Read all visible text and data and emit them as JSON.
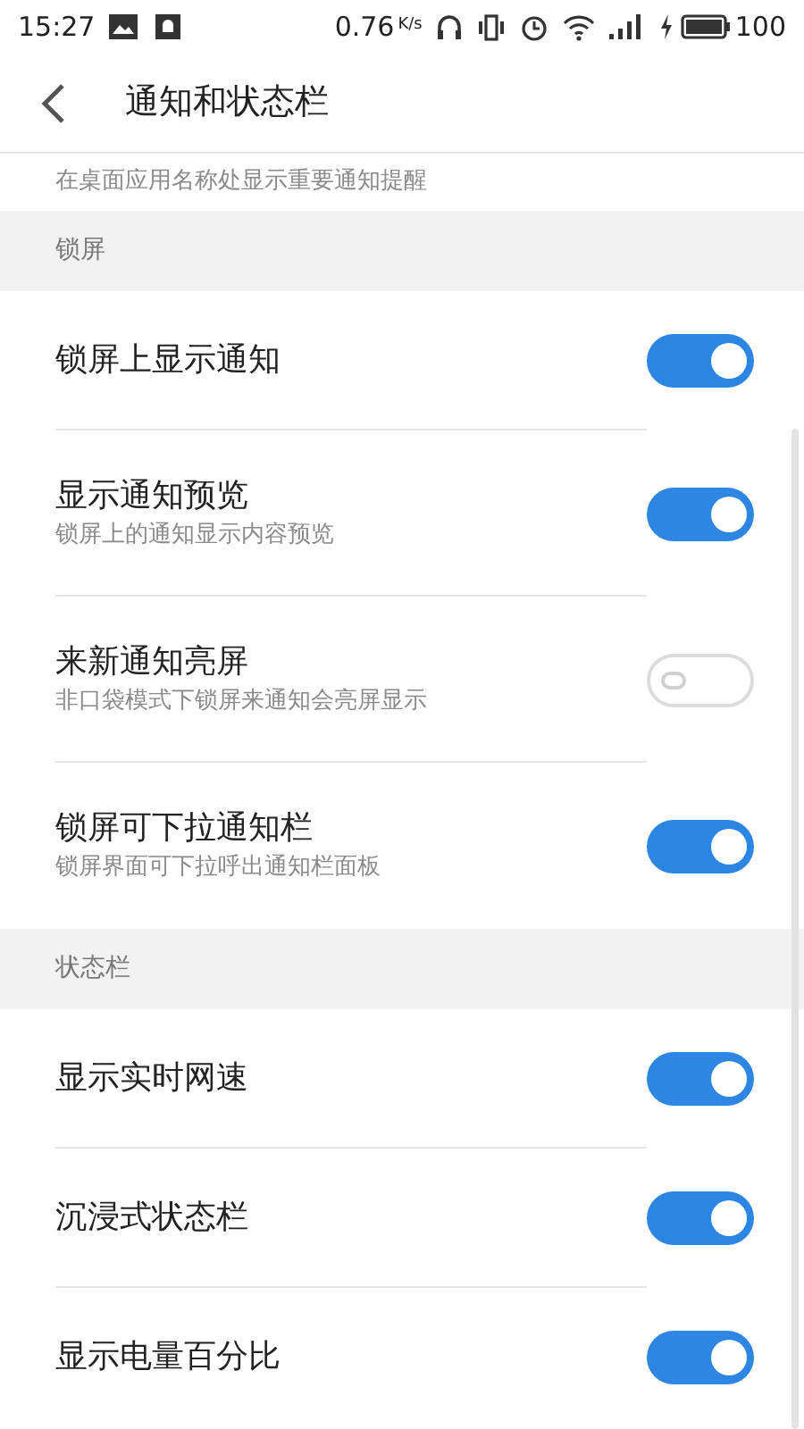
{
  "status_bar": {
    "time": "15:27",
    "speed": "0.76",
    "speed_unit": "K/s",
    "battery": "100"
  },
  "header": {
    "title": "通知和状态栏"
  },
  "cut_text": "在桌面应用名称处显示重要通知提醒",
  "sections": [
    {
      "title": "锁屏",
      "items": [
        {
          "label": "锁屏上显示通知",
          "on": true
        },
        {
          "label": "显示通知预览",
          "description": "锁屏上的通知显示内容预览",
          "on": true
        },
        {
          "label": "来新通知亮屏",
          "description": "非口袋模式下锁屏来通知会亮屏显示",
          "on": false
        },
        {
          "label": "锁屏可下拉通知栏",
          "description": "锁屏界面可下拉呼出通知栏面板",
          "on": true
        }
      ]
    },
    {
      "title": "状态栏",
      "items": [
        {
          "label": "显示实时网速",
          "on": true
        },
        {
          "label": "沉浸式状态栏",
          "on": true
        },
        {
          "label": "显示电量百分比",
          "on": true
        }
      ]
    }
  ]
}
